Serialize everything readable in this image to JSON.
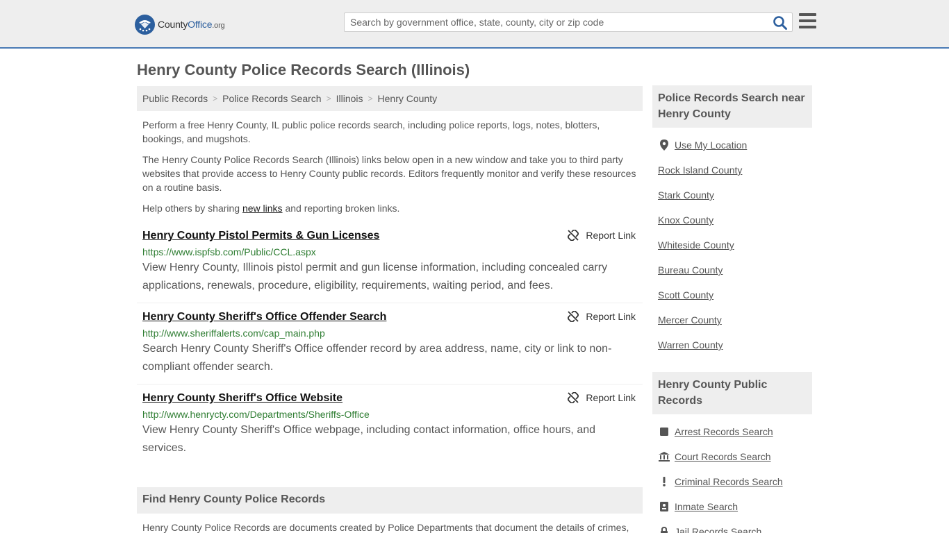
{
  "header": {
    "logo_county": "County",
    "logo_office": "Office",
    "logo_org": ".org",
    "search_placeholder": "Search by government office, state, county, city or zip code"
  },
  "page_title": "Henry County Police Records Search (Illinois)",
  "breadcrumb": [
    "Public Records",
    "Police Records Search",
    "Illinois",
    "Henry County"
  ],
  "intro": {
    "p1": "Perform a free Henry County, IL public police records search, including police reports, logs, notes, blotters, bookings, and mugshots.",
    "p2": "The Henry County Police Records Search (Illinois) links below open in a new window and take you to third party websites that provide access to Henry County public records. Editors frequently monitor and verify these resources on a routine basis.",
    "p3_before": "Help others by sharing ",
    "p3_link": "new links",
    "p3_after": " and reporting broken links."
  },
  "results": [
    {
      "title": "Henry County Pistol Permits & Gun Licenses",
      "url": "https://www.ispfsb.com/Public/CCL.aspx",
      "desc": "View Henry County, Illinois pistol permit and gun license information, including concealed carry applications, renewals, procedure, eligibility, requirements, waiting period, and fees.",
      "report": "Report Link"
    },
    {
      "title": "Henry County Sheriff's Office Offender Search",
      "url": "http://www.sheriffalerts.com/cap_main.php",
      "desc": "Search Henry County Sheriff's Office offender record by area address, name, city or link to non-compliant offender search.",
      "report": "Report Link"
    },
    {
      "title": "Henry County Sheriff's Office Website",
      "url": "http://www.henrycty.com/Departments/Sheriffs-Office",
      "desc": "View Henry County Sheriff's Office webpage, including contact information, office hours, and services.",
      "report": "Report Link"
    }
  ],
  "find_section": {
    "heading": "Find Henry County Police Records",
    "text": "Henry County Police Records are documents created by Police Departments that document the details of crimes,"
  },
  "sidebar": {
    "nearby_heading": "Police Records Search near Henry County",
    "use_location": "Use My Location",
    "nearby": [
      "Rock Island County",
      "Stark County",
      "Knox County",
      "Whiteside County",
      "Bureau County",
      "Scott County",
      "Mercer County",
      "Warren County"
    ],
    "public_heading": "Henry County Public Records",
    "public_links": [
      {
        "label": "Arrest Records Search",
        "icon": "square-icon"
      },
      {
        "label": "Court Records Search",
        "icon": "courthouse-icon"
      },
      {
        "label": "Criminal Records Search",
        "icon": "exclamation-icon"
      },
      {
        "label": "Inmate Search",
        "icon": "id-badge-icon"
      },
      {
        "label": "Jail Records Search",
        "icon": "lock-icon"
      }
    ]
  }
}
